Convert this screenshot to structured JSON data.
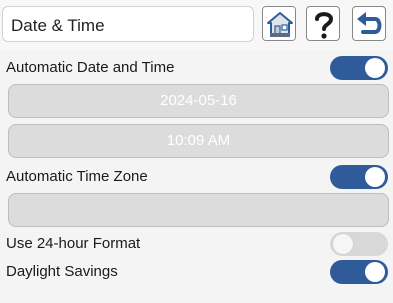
{
  "header": {
    "title": "Date & Time",
    "buttons": [
      {
        "name": "home-button",
        "icon": "home-icon"
      },
      {
        "name": "help-button",
        "icon": "question-mark-icon"
      },
      {
        "name": "back-button",
        "icon": "return-arrow-icon"
      }
    ]
  },
  "settings": {
    "auto_date_time": {
      "label": "Automatic Date and Time",
      "enabled": true
    },
    "date_field": {
      "value": "2024-05-16"
    },
    "time_field": {
      "value": "10:09 AM"
    },
    "auto_time_zone": {
      "label": "Automatic Time Zone",
      "enabled": true
    },
    "time_zone_field": {
      "value": ""
    },
    "use_24_hour": {
      "label": "Use 24-hour Format",
      "enabled": false
    },
    "daylight_savings": {
      "label": "Daylight Savings",
      "enabled": true
    }
  },
  "colors": {
    "toggle_on": "#2f5b9b",
    "toggle_off": "#d8d8d8",
    "field_bg": "#dcdcdc",
    "icon_blue": "#2f5b9b"
  }
}
